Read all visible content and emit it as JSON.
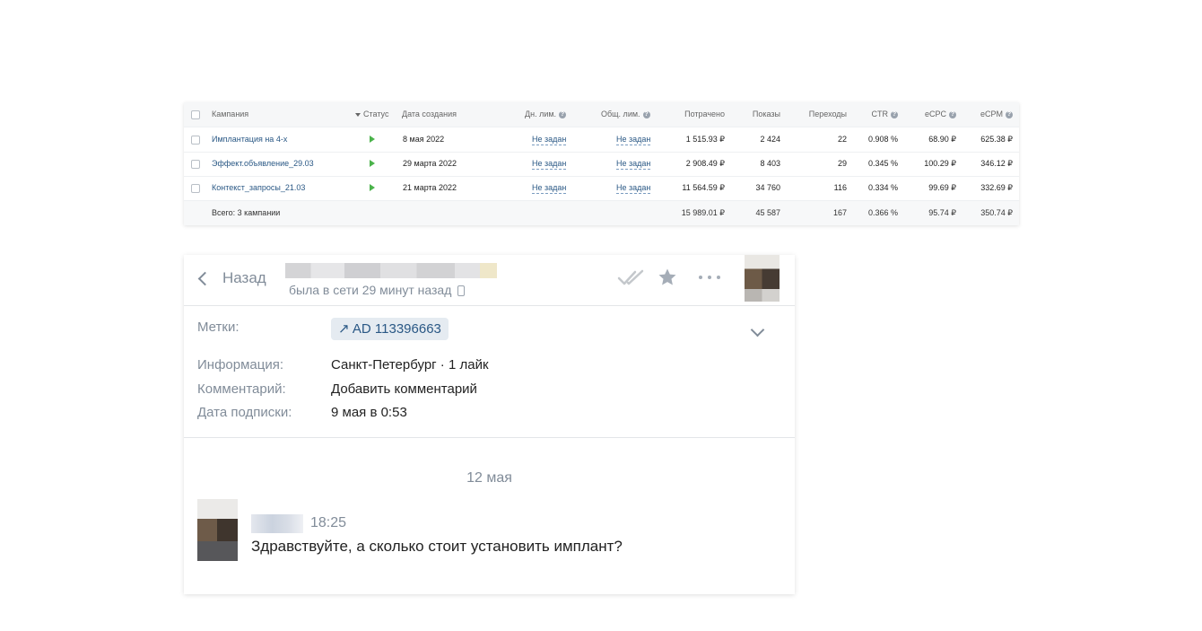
{
  "campaigns_table": {
    "headers": {
      "campaign": "Кампания",
      "status": "Статус",
      "created": "Дата создания",
      "day_limit": "Дн. лим.",
      "total_limit": "Общ. лим.",
      "spent": "Потрачено",
      "impressions": "Показы",
      "clicks": "Переходы",
      "ctr": "CTR",
      "ecpc": "eCPC",
      "ecpm": "eCPM"
    },
    "rows": [
      {
        "name": "Имплантация на 4-х",
        "status": "active",
        "created": "8 мая 2022",
        "day_limit": "Не задан",
        "total_limit": "Не задан",
        "spent": "1 515.93 ₽",
        "impressions": "2 424",
        "clicks": "22",
        "ctr": "0.908 %",
        "ecpc": "68.90 ₽",
        "ecpm": "625.38 ₽"
      },
      {
        "name": "Эффект.объявление_29.03",
        "status": "active",
        "created": "29 марта 2022",
        "day_limit": "Не задан",
        "total_limit": "Не задан",
        "spent": "2 908.49 ₽",
        "impressions": "8 403",
        "clicks": "29",
        "ctr": "0.345 %",
        "ecpc": "100.29 ₽",
        "ecpm": "346.12 ₽"
      },
      {
        "name": "Контекст_запросы_21.03",
        "status": "active",
        "created": "21 марта 2022",
        "day_limit": "Не задан",
        "total_limit": "Не задан",
        "spent": "11 564.59 ₽",
        "impressions": "34 760",
        "clicks": "116",
        "ctr": "0.334 %",
        "ecpc": "99.69 ₽",
        "ecpm": "332.69 ₽"
      }
    ],
    "total": {
      "label": "Всего: 3 кампании",
      "spent": "15 989.01 ₽",
      "impressions": "45 587",
      "clicks": "167",
      "ctr": "0.366 %",
      "ecpc": "95.74 ₽",
      "ecpm": "350.74 ₽"
    },
    "help_glyph": "?",
    "status_color": "#4bb34b"
  },
  "chat": {
    "back_label": "Назад",
    "last_seen": "была в сети 29 минут назад",
    "labels": {
      "tags": "Метки:",
      "info": "Информация:",
      "comment": "Комментарий:",
      "subscribed": "Дата подписки:"
    },
    "tag_chip": "↗ AD 113396663",
    "info_value": "Санкт-Петербург · 1 лайк",
    "comment_value": "Добавить комментарий",
    "subscribed_value": "9 мая в 0:53",
    "date_separator": "12 мая",
    "message": {
      "time": "18:25",
      "text": "Здравствуйте, а сколько стоит установить имплант?"
    },
    "icons": [
      "back-chevron-icon",
      "phone-icon",
      "double-check-icon",
      "star-icon",
      "more-icon",
      "chevron-down-icon"
    ],
    "link_color": "#2a5885"
  }
}
